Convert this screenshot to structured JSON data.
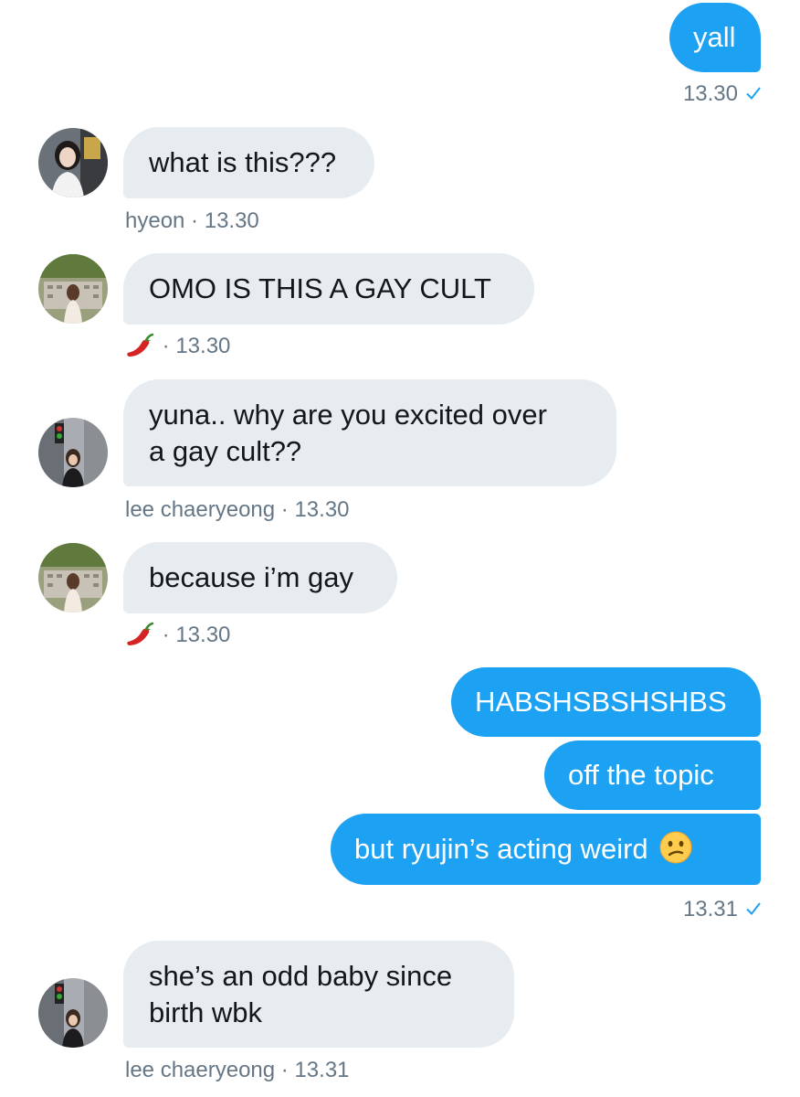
{
  "messages": {
    "m1": {
      "text": "yall",
      "time": "13.30"
    },
    "m2": {
      "text": "what is this???",
      "sender": "hyeon",
      "time": "13.30"
    },
    "m3": {
      "text": "OMO IS THIS A GAY CULT",
      "sender_icon": "chili-pepper-emoji",
      "time": "13.30"
    },
    "m4": {
      "line1": "yuna.. why are you excited over",
      "line2": "a gay cult??",
      "sender": "lee chaeryeong",
      "time": "13.30"
    },
    "m5": {
      "text": "because i’m gay",
      "sender_icon": "chili-pepper-emoji",
      "time": "13.30"
    },
    "m6": {
      "text": "HABSHSBSHSHBS"
    },
    "m7": {
      "text": "off the topic"
    },
    "m8": {
      "text": "but ryujin’s acting weird",
      "emoji": "confused-face-emoji",
      "time": "13.31"
    },
    "m9": {
      "line1": "she’s an odd baby since",
      "line2": "birth wbk",
      "sender": "lee chaeryeong",
      "time": "13.31"
    }
  },
  "separator": " · ",
  "colors": {
    "outgoing_bubble": "#1da1f2",
    "incoming_bubble": "#e6ecf0",
    "meta_text": "#657786",
    "check": "#1da1f2"
  }
}
